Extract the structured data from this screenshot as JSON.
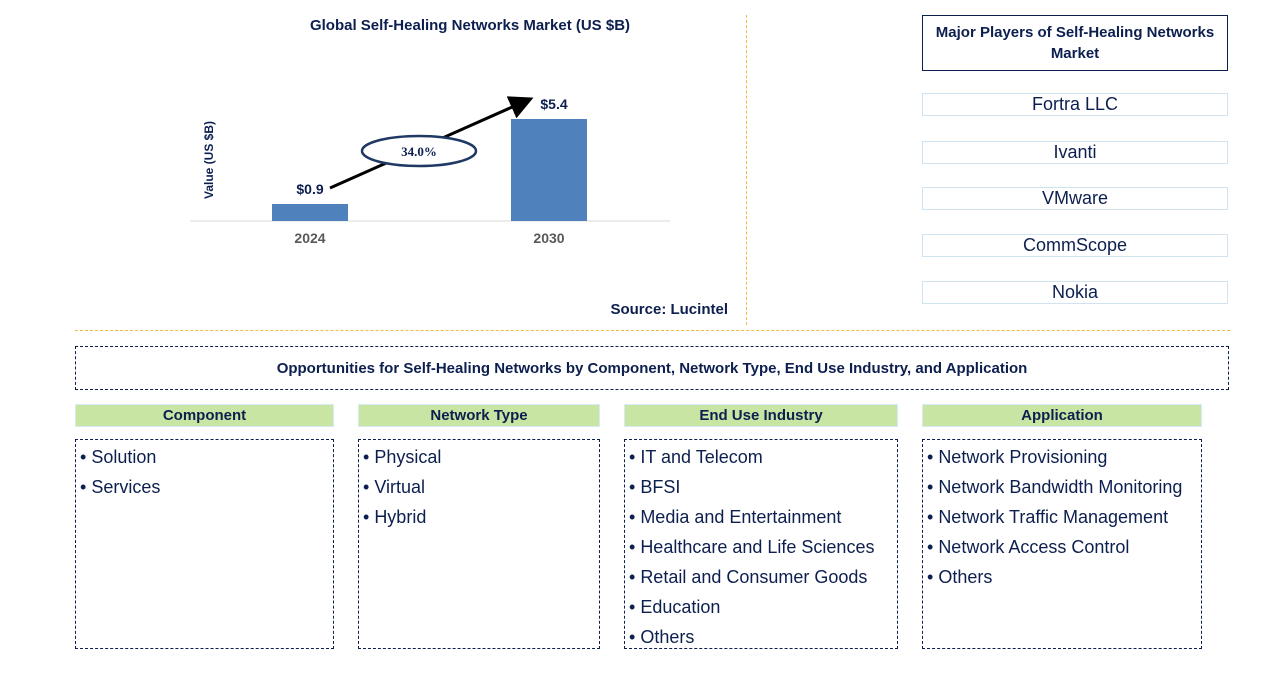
{
  "chart_data": {
    "type": "bar",
    "title": "Global Self-Healing Networks Market (US $B)",
    "xlabel": "",
    "ylabel": "Value (US $B)",
    "categories": [
      "2024",
      "2030"
    ],
    "values": [
      0.9,
      5.4
    ],
    "data_labels": [
      "$0.9",
      "$5.4"
    ],
    "ylim": [
      0,
      6
    ],
    "grid": false,
    "bar_color": "#4f81bd",
    "annotation": {
      "type": "cagr-arrow",
      "label": "34.0%"
    },
    "source": "Source: Lucintel"
  },
  "players": {
    "title": "Major Players of Self-Healing Networks Market",
    "items": [
      "Fortra LLC",
      "Ivanti",
      "VMware",
      "CommScope",
      "Nokia"
    ]
  },
  "opportunities": {
    "title": "Opportunities for Self-Healing Networks by Component, Network Type, End Use Industry, and Application",
    "categories": [
      {
        "name": "Component",
        "items": [
          "Solution",
          "Services"
        ]
      },
      {
        "name": "Network Type",
        "items": [
          "Physical",
          "Virtual",
          "Hybrid"
        ]
      },
      {
        "name": "End Use Industry",
        "items": [
          "IT and Telecom",
          "BFSI",
          "Media and Entertainment",
          "Healthcare and Life Sciences",
          "Retail and Consumer Goods",
          "Education",
          "Others"
        ]
      },
      {
        "name": "Application",
        "items": [
          "Network Provisioning",
          "Network Bandwidth Monitoring",
          "Network Traffic Management",
          "Network Access Control",
          "Others"
        ]
      }
    ]
  },
  "colors": {
    "text": "#0d1f4f",
    "header_green": "#c9e5a3",
    "divider": "#f5b942",
    "bar": "#4f81bd"
  }
}
